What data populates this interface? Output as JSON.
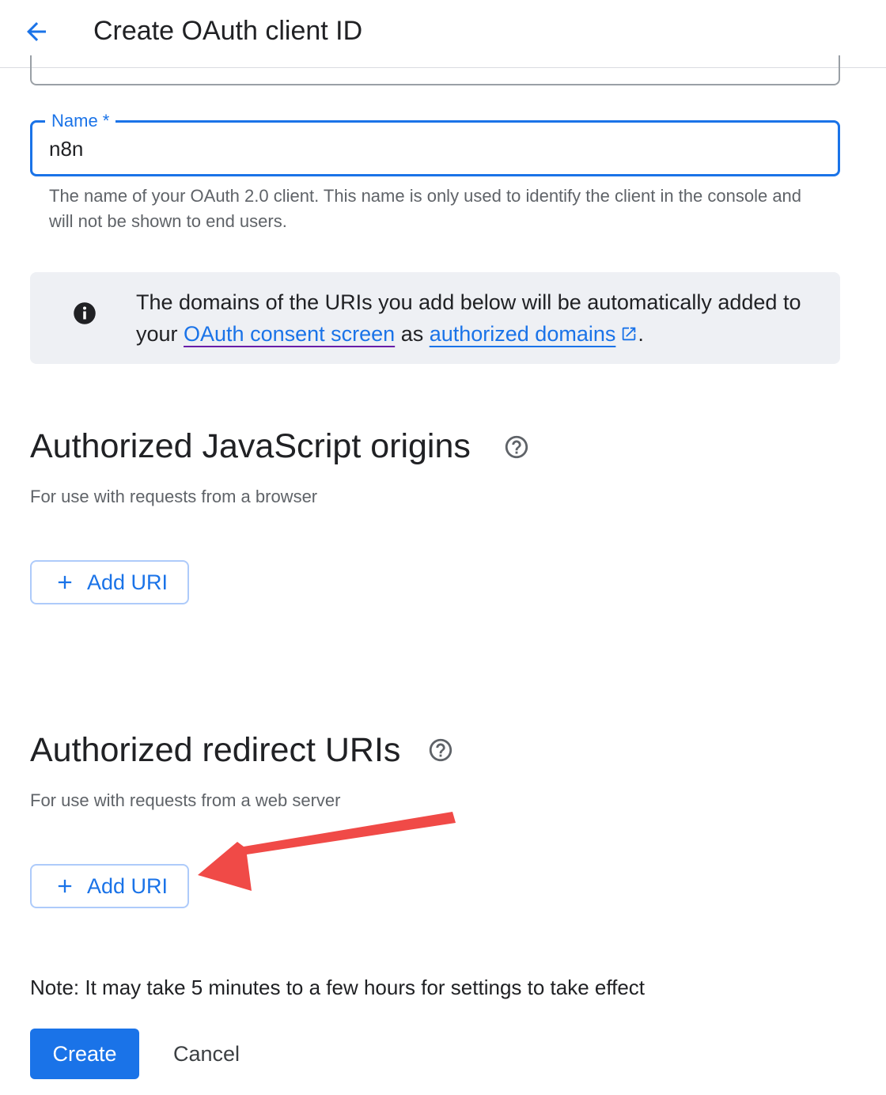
{
  "header": {
    "title": "Create OAuth client ID",
    "back_icon": "arrow-back-icon"
  },
  "name_field": {
    "label": "Name *",
    "value": "n8n",
    "helper": "The name of your OAuth 2.0 client. This name is only used to identify the client in the console and will not be shown to end users."
  },
  "info": {
    "icon": "info-icon",
    "text_before": "The domains of the URIs you add below will be automatically added to your ",
    "link1": "OAuth consent screen",
    "text_middle": " as ",
    "link2": "authorized domains",
    "text_after": "."
  },
  "js_origins": {
    "title": "Authorized JavaScript origins",
    "subtitle": "For use with requests from a browser",
    "add_label": "Add URI"
  },
  "redirect_uris": {
    "title": "Authorized redirect URIs",
    "subtitle": "For use with requests from a web server",
    "add_label": "Add URI"
  },
  "note": "Note: It may take 5 minutes to a few hours for settings to take effect",
  "actions": {
    "create": "Create",
    "cancel": "Cancel"
  },
  "colors": {
    "accent": "#1a73e8",
    "annotation_arrow": "#f04a47",
    "info_bg": "#eef0f4"
  }
}
